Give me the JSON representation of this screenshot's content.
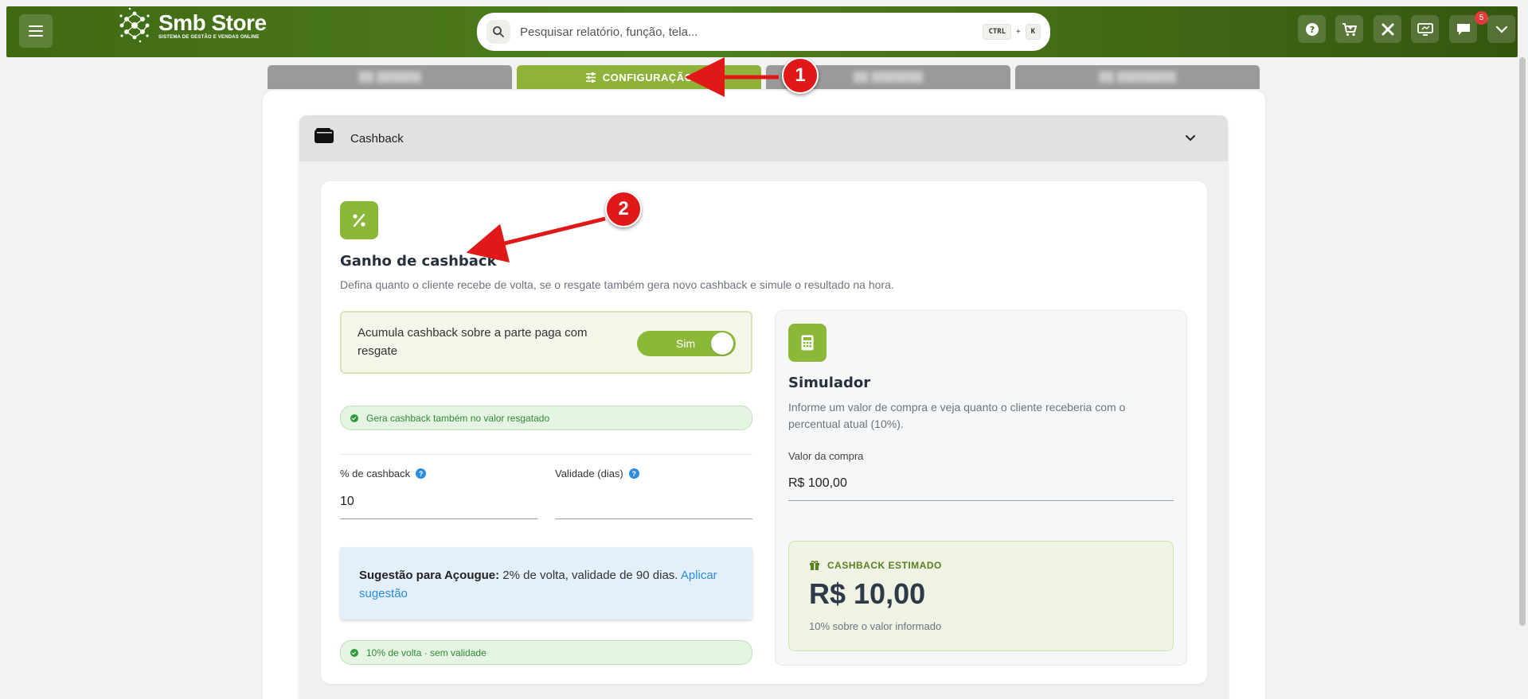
{
  "header": {
    "menu_icon": "hamburger-menu-icon",
    "logo_name": "Smb Store",
    "logo_tagline": "SISTEMA DE GESTÃO E VENDAS ONLINE",
    "search_placeholder": "Pesquisar relatório, função, tela...",
    "shortcut_key1": "CTRL",
    "shortcut_plus": "+",
    "shortcut_key2": "K",
    "actions": [
      "help-icon",
      "cart-icon",
      "tools-icon",
      "monitor-icon",
      "chat-icon",
      "chevron-down-icon"
    ],
    "notification_count": "5"
  },
  "tabs": {
    "active_label": "CONFIGURAÇÃO",
    "blurred": [
      "██ ██████",
      "██ ███████",
      "██ ████████"
    ]
  },
  "accordion": {
    "title": "Cashback",
    "icon": "wallet-icon"
  },
  "section": {
    "title": "Ganho de cashback",
    "description": "Defina quanto o cliente recebe de volta, se o resgate também gera novo cashback e simule o resultado na hora.",
    "toggle_label": "Acumula cashback sobre a parte paga com resgate",
    "toggle_value": "Sim",
    "toggle_info": "Gera cashback também no valor resgatado",
    "percent_label": "% de cashback",
    "percent_value": "10",
    "validity_label": "Validade (dias)",
    "validity_value": "",
    "suggestion_bold": "Sugestão para Açougue:",
    "suggestion_text": " 2% de volta, validade de 90 dias. ",
    "suggestion_link": "Aplicar sugestão",
    "summary": "10% de volta · sem validade"
  },
  "simulator": {
    "title": "Simulador",
    "description": "Informe um valor de compra e veja quanto o cliente receberia com o percentual atual (10%).",
    "purchase_label": "Valor da compra",
    "purchase_value": "R$ 100,00",
    "estimate_heading": "CASHBACK ESTIMADO",
    "estimate_value": "R$ 10,00",
    "estimate_note": "10% sobre o valor informado"
  },
  "annotations": {
    "marker1": "1",
    "marker2": "2"
  },
  "colors": {
    "brand_green": "#4f7f1c",
    "accent_green": "#8cb83a",
    "annotation_red": "#e01818",
    "link_blue": "#2a8de0"
  }
}
